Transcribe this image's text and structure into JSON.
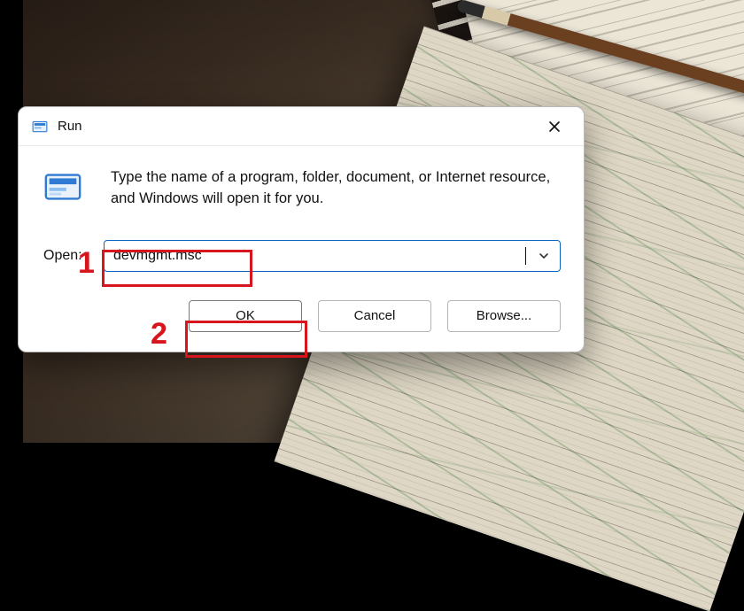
{
  "dialog": {
    "title": "Run",
    "instruction": "Type the name of a program, folder, document, or Internet resource, and Windows will open it for you.",
    "open_label": "Open:",
    "open_value": "devmgmt.msc",
    "buttons": {
      "ok": "OK",
      "cancel": "Cancel",
      "browse": "Browse..."
    }
  },
  "annotations": {
    "one": "1",
    "two": "2"
  }
}
